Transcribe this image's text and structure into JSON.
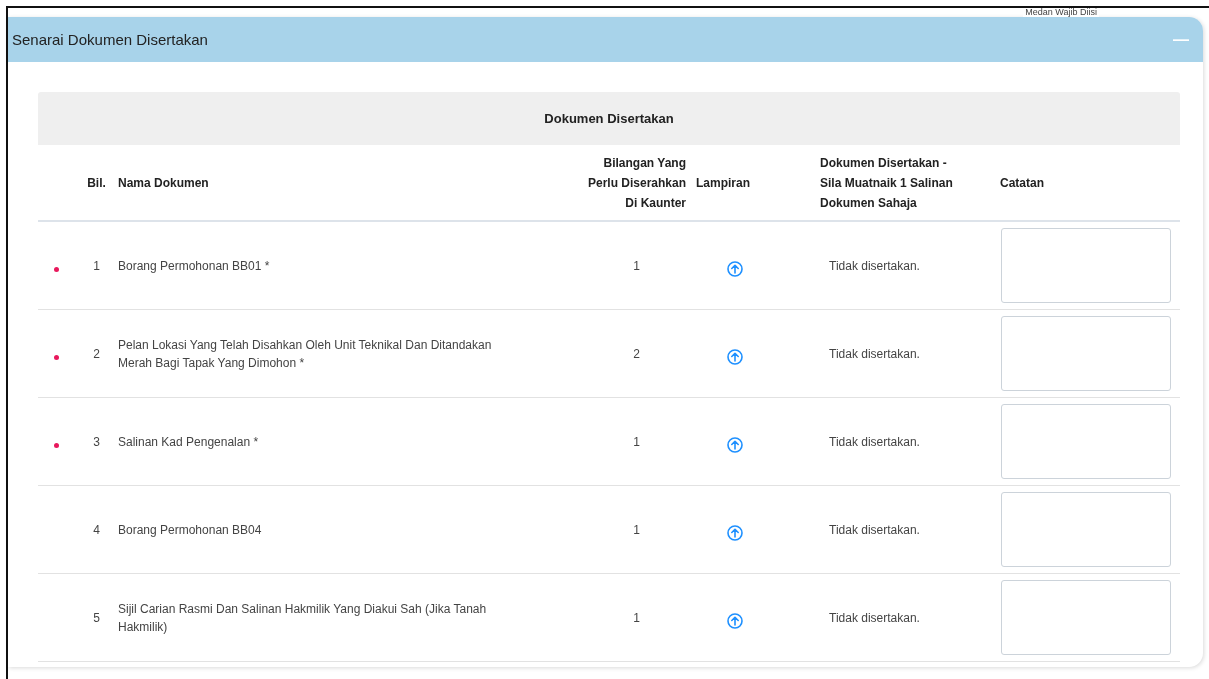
{
  "corner_note": "Medan Wajib Diisi",
  "panel": {
    "title": "Senarai Dokumen Disertakan",
    "collapse_symbol": "—"
  },
  "table": {
    "group_heading": "Dokumen Disertakan",
    "columns": [
      "Bil.",
      "Nama Dokumen",
      "Bilangan Yang Perlu Diserahkan Di Kaunter",
      "Lampiran",
      "Dokumen Disertakan - Sila Muatnaik 1 Salinan Dokumen Sahaja",
      "Catatan"
    ],
    "rows": [
      {
        "required": true,
        "number": "1",
        "name": "Borang Permohonan BB01 *",
        "count": "1",
        "status": "Tidak disertakan."
      },
      {
        "required": true,
        "number": "2",
        "name": "Pelan Lokasi Yang Telah Disahkan Oleh Unit Teknikal Dan Ditandakan Merah Bagi Tapak Yang Dimohon *",
        "count": "2",
        "status": "Tidak disertakan."
      },
      {
        "required": true,
        "number": "3",
        "name": "Salinan Kad Pengenalan *",
        "count": "1",
        "status": "Tidak disertakan."
      },
      {
        "required": false,
        "number": "4",
        "name": "Borang Permohonan BB04",
        "count": "1",
        "status": "Tidak disertakan."
      },
      {
        "required": false,
        "number": "5",
        "name": "Sijil Carian Rasmi Dan Salinan Hakmilik Yang Diakui Sah (Jika Tanah Hakmilik)",
        "count": "1",
        "status": "Tidak disertakan."
      }
    ]
  }
}
